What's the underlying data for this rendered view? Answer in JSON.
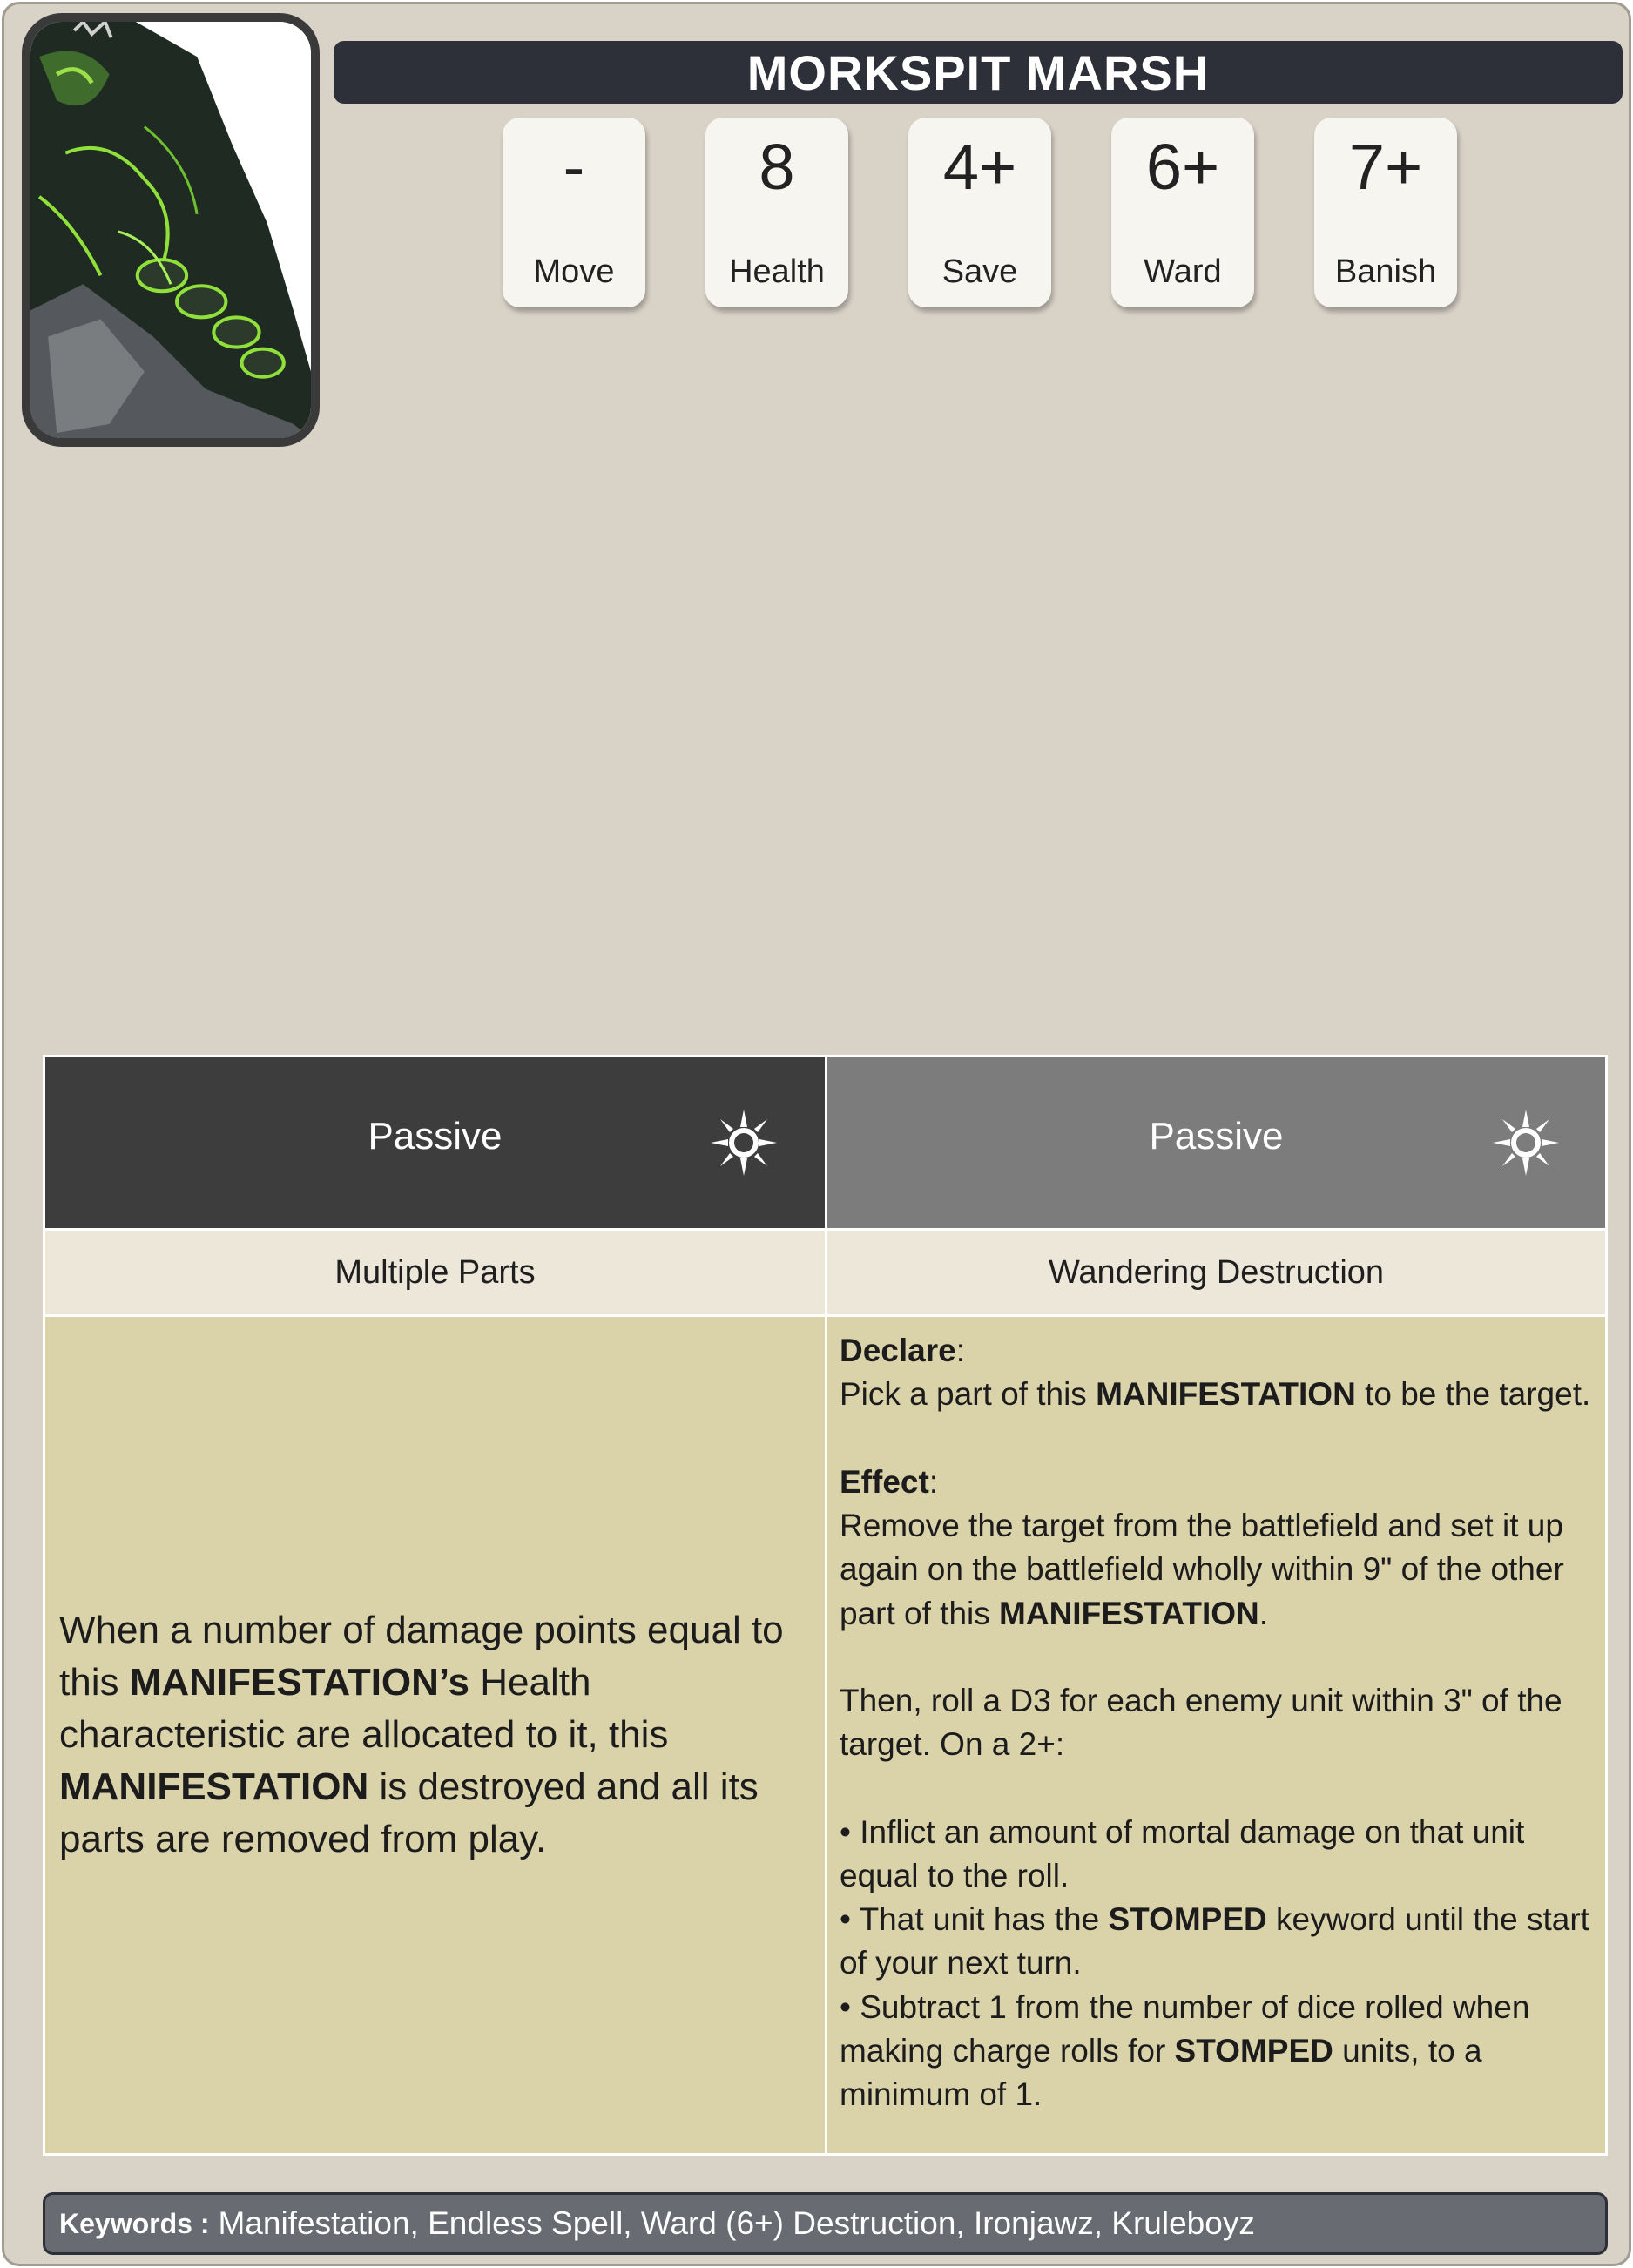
{
  "card": {
    "title": "MORKSPIT MARSH",
    "portrait_alt": "portrait-image"
  },
  "stats": [
    {
      "value": "-",
      "label": "Move"
    },
    {
      "value": "8",
      "label": "Health"
    },
    {
      "value": "4+",
      "label": "Save"
    },
    {
      "value": "6+",
      "label": "Ward"
    },
    {
      "value": "7+",
      "label": "Banish"
    }
  ],
  "abilities": [
    {
      "type": "Passive",
      "icon": "sun-icon",
      "name": "Multiple Parts",
      "text_1": "When a number of damage points equal to this ",
      "text_2": "MANIFESTATION’s",
      "text_3": " Health characteristic are allocated to it, this ",
      "text_4": "MANIFESTATION",
      "text_5": " is destroyed and all its parts are removed from play."
    },
    {
      "type": "Passive",
      "icon": "sun-icon",
      "name": "Wandering Destruction",
      "declare_label": "Declare",
      "declare_1": "Pick a part of this ",
      "declare_2": "MANIFESTATION",
      "declare_3": " to be the target.",
      "effect_label": "Effect",
      "effect_1": "Remove the target from the battlefield and set it up again on the battlefield wholly within 9\" of the other part of this ",
      "effect_2": "MANIFESTATION",
      "effect_3": ".",
      "then": "Then, roll a D3 for each enemy unit within 3\" of the target. On a 2+:",
      "bullet_1": "• Inflict an amount of mortal damage on that unit equal to the roll.",
      "bullet_2a": "• That unit has the ",
      "bullet_2b": "STOMPED",
      "bullet_2c": " keyword until the start of your next turn.",
      "bullet_3a": "• Subtract 1 from the number of dice rolled when making charge rolls for ",
      "bullet_3b": "STOMPED",
      "bullet_3c": " units, to a minimum of 1."
    }
  ],
  "keywords": {
    "label": "Keywords :",
    "values": "Manifestation, Endless Spell, Ward (6+) Destruction, Ironjawz, Kruleboyz"
  },
  "colors": {
    "card_bg": "#d8d2c7",
    "title_bg": "#2d3038",
    "passive_dark": "#3d3d3d",
    "passive_light": "#7c7c7c",
    "ability_body": "#dad2a8",
    "ability_name_bg": "#ede7d9",
    "keywords_bg": "#686b72"
  }
}
